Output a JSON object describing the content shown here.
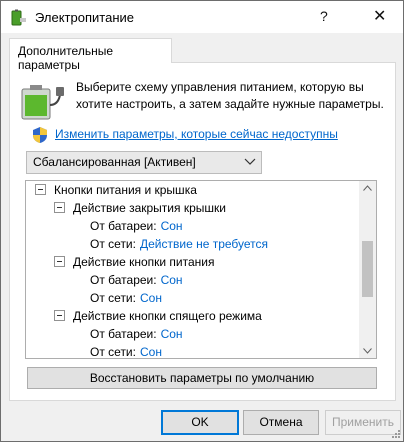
{
  "window": {
    "title": "Электропитание",
    "help_glyph": "?",
    "close_glyph": "✕"
  },
  "tab": {
    "label": "Дополнительные параметры"
  },
  "description": "Выберите схему управления питанием, которую вы хотите настроить, а затем задайте нужные параметры.",
  "change_link": "Изменить параметры, которые сейчас недоступны",
  "plan_select": {
    "value": "Сбалансированная [Активен]"
  },
  "tree": {
    "root": "Кнопки питания и крышка",
    "groups": [
      {
        "label": "Действие закрытия крышки",
        "on_battery_label": "От батареи:",
        "on_battery_value": "Сон",
        "plugged_label": "От сети:",
        "plugged_value": "Действие не требуется"
      },
      {
        "label": "Действие кнопки питания",
        "on_battery_label": "От батареи:",
        "on_battery_value": "Сон",
        "plugged_label": "От сети:",
        "plugged_value": "Сон"
      },
      {
        "label": "Действие кнопки спящего режима",
        "on_battery_label": "От батареи:",
        "on_battery_value": "Сон",
        "plugged_label": "От сети:",
        "plugged_value": "Сон"
      }
    ]
  },
  "restore_button": "Восстановить параметры по умолчанию",
  "buttons": {
    "ok": "OK",
    "cancel": "Отмена",
    "apply": "Применить"
  },
  "colors": {
    "link": "#0066cc",
    "focus": "#0078d7",
    "disabled_text": "#a0a0a0"
  }
}
